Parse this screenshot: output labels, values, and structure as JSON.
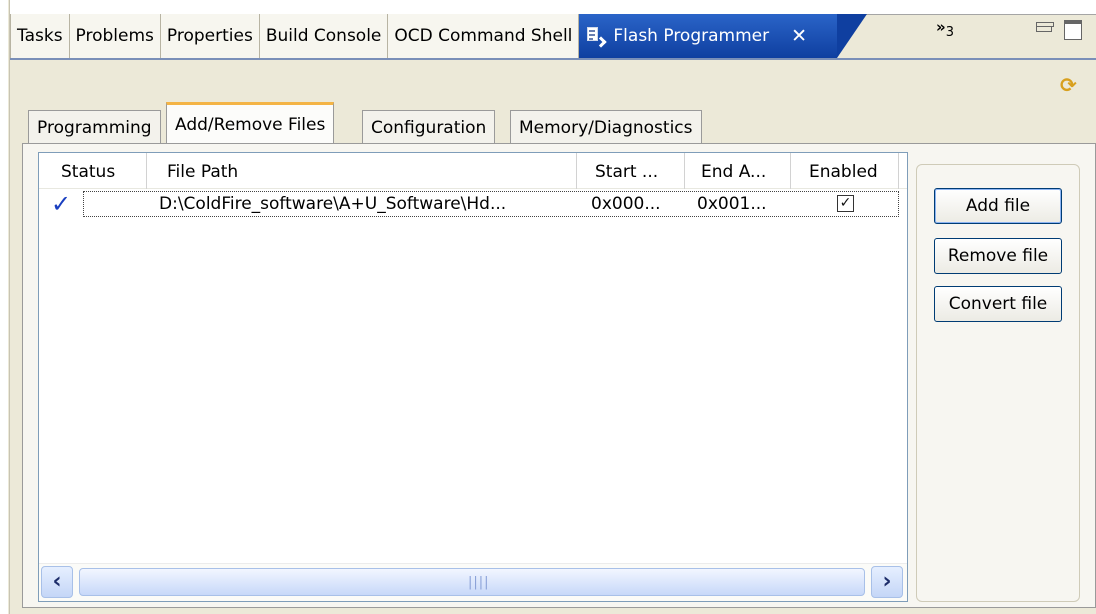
{
  "view_tabs": [
    {
      "label": "Tasks"
    },
    {
      "label": "Problems"
    },
    {
      "label": "Properties"
    },
    {
      "label": "Build Console"
    },
    {
      "label": "OCD Command Shell"
    },
    {
      "label": "Flash Programmer",
      "active": true
    }
  ],
  "view_overflow": {
    "chevron": "»",
    "count": "3"
  },
  "inner_tabs": [
    {
      "label": "Programming"
    },
    {
      "label": "Add/Remove Files",
      "active": true
    },
    {
      "label": "Configuration"
    },
    {
      "label": "Memory/Diagnostics"
    }
  ],
  "file_table": {
    "columns": [
      "Status",
      "File Path",
      "Start ...",
      "End A...",
      "Enabled"
    ],
    "rows": [
      {
        "status_icon": "checkmark-icon",
        "file_path": "D:\\ColdFire_software\\A+U_Software\\Hd...",
        "start": "0x000...",
        "end": "0x001...",
        "enabled": true
      }
    ]
  },
  "buttons": {
    "add": "Add file",
    "remove": "Remove file",
    "convert": "Convert file"
  },
  "icons": {
    "close": "close-icon",
    "sync": "sync-icon",
    "minimize": "minimize-icon",
    "maximize": "maximize-icon"
  },
  "colors": {
    "active_tab": "#1f54b8",
    "inner_active_tab_accent": "#f4b445",
    "panel_bg": "#ece9d8"
  }
}
